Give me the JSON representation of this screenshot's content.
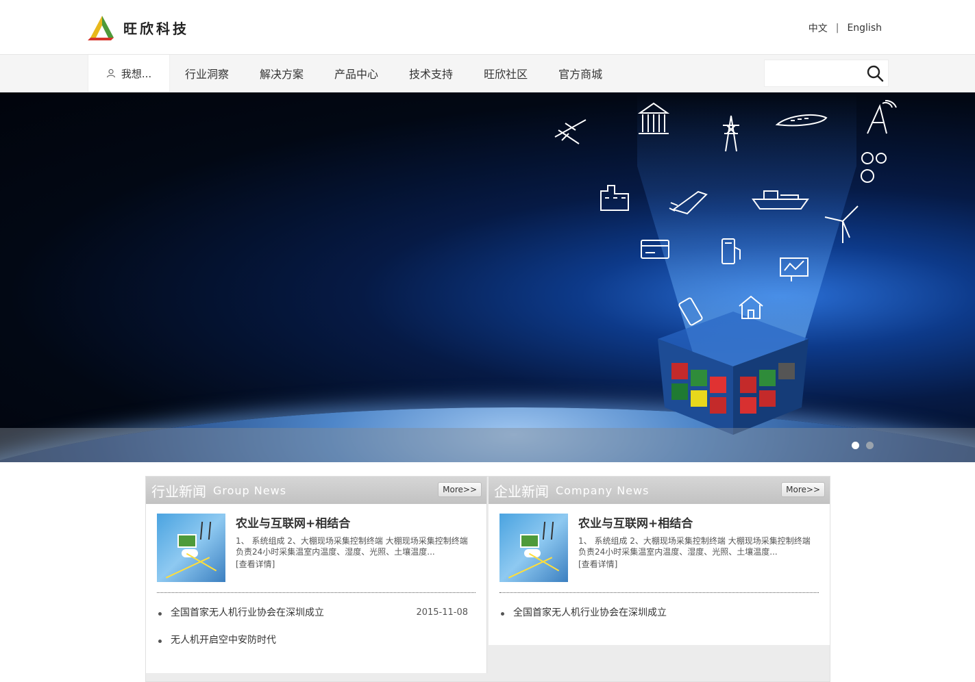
{
  "logo": {
    "text": "旺欣科技"
  },
  "lang": {
    "zh": "中文",
    "sep": "|",
    "en": "English"
  },
  "nav": {
    "want_label": "我想...",
    "items": [
      "行业洞察",
      "解决方案",
      "产品中心",
      "技术支持",
      "旺欣社区",
      "官方商城"
    ]
  },
  "search": {
    "value": "",
    "placeholder": ""
  },
  "banner": {
    "slides": 2,
    "active_slide": 1
  },
  "news_left": {
    "title_cn": "行业新闻",
    "title_en": "Group News",
    "more": "More>>",
    "feature": {
      "title": "农业与互联网+相结合",
      "text": "1、 系统组成 2、大棚现场采集控制终端 大棚现场采集控制终端负责24小时采集温室内温度、湿度、光照、土壤温度...",
      "link": "[查看详情]"
    },
    "items": [
      {
        "title": "全国首家无人机行业协会在深圳成立",
        "date": "2015-11-08"
      },
      {
        "title": "无人机开启空中安防时代",
        "date": ""
      }
    ]
  },
  "news_right": {
    "title_cn": "企业新闻",
    "title_en": "Company News",
    "more": "More>>",
    "feature": {
      "title": "农业与互联网+相结合",
      "text": "1、 系统组成 2、大棚现场采集控制终端 大棚现场采集控制终端负责24小时采集温室内温度、湿度、光照、土壤温度...",
      "link": "[查看详情]"
    },
    "items": [
      {
        "title": "全国首家无人机行业协会在深圳成立",
        "date": ""
      }
    ]
  },
  "colors": {
    "banner_glow": "#2a6fd6",
    "logo_green": "#4e9a3a",
    "logo_red": "#d6352b",
    "logo_yellow": "#e8b81c"
  }
}
